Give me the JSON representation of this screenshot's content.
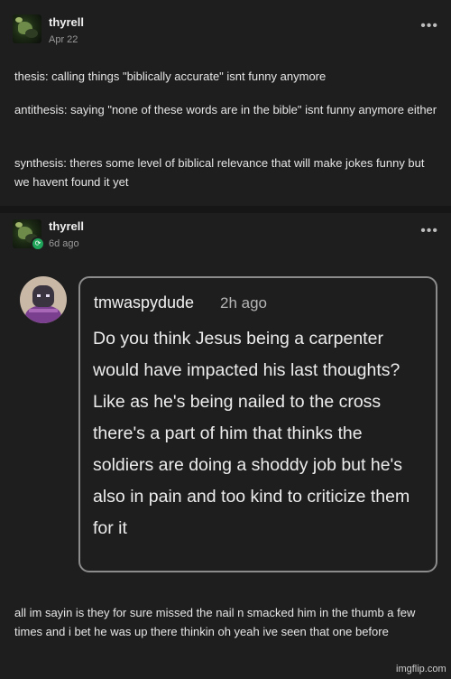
{
  "post1": {
    "username": "thyrell",
    "date": "Apr 22",
    "paragraphs": [
      "thesis: calling things \"biblically accurate\" isnt funny anymore",
      "antithesis: saying \"none of these words are in the bible\" isnt funny anymore either",
      "synthesis: theres some level of biblical relevance that will make jokes funny but we havent found it yet"
    ]
  },
  "post2": {
    "username": "thyrell",
    "date": "6d ago",
    "reply": {
      "username": "tmwaspydude",
      "time": "2h ago",
      "text": "Do you think Jesus being a carpenter would have impacted his last thoughts? Like as he's being nailed to the cross there's a part of him that thinks the soldiers are doing a shoddy job but he's also in pain and too kind to criticize them for it"
    },
    "text": "all im sayin is they for sure missed the nail n smacked him in the thumb a few times and i bet he was up there thinkin oh yeah ive seen that one before"
  },
  "icons": {
    "more": "more-dots-icon",
    "reblog": "reblog-icon"
  },
  "badge_glyph": "⟳",
  "more_glyph": "•••",
  "footer": "imgflip.com",
  "colors": {
    "background": "#1e1e1e",
    "text": "#e9e9e9",
    "muted": "#9a9a9a",
    "badge": "#1fa45a",
    "bubble_border": "#8c8c8c"
  }
}
